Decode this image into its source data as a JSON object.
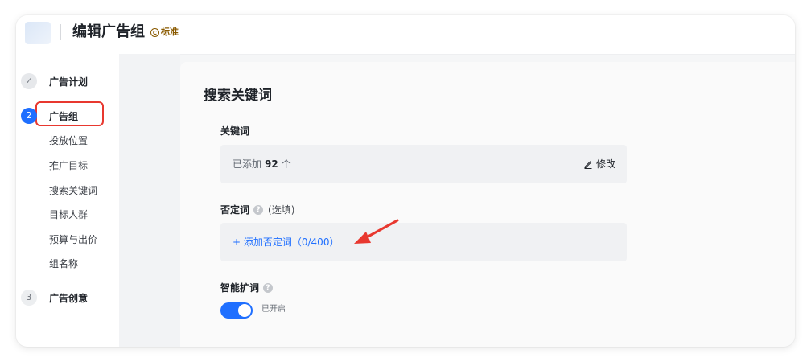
{
  "header": {
    "title": "编辑广告组",
    "badge_icon": "C",
    "badge": "标准"
  },
  "sidebar": {
    "steps": [
      {
        "number": "✓",
        "label": "广告计划",
        "state": "done"
      },
      {
        "number": "2",
        "label": "广告组",
        "state": "active"
      },
      {
        "number": "3",
        "label": "广告创意",
        "state": "todo"
      }
    ],
    "sub_items": [
      "投放位置",
      "推广目标",
      "搜索关键词",
      "目标人群",
      "预算与出价",
      "组名称"
    ]
  },
  "main": {
    "section_title": "搜索关键词",
    "keywords": {
      "label": "关键词",
      "added_prefix": "已添加",
      "count": "92",
      "added_suffix": "个",
      "edit_label": "修改"
    },
    "negative": {
      "label": "否定词",
      "optional": "(选填)",
      "add_label": "+ 添加否定词（0/400）"
    },
    "smart": {
      "label": "智能扩词",
      "toggle_on": true,
      "toggle_status": "已开启"
    }
  },
  "colors": {
    "accent": "#1f6fff",
    "highlight_red": "#e8382f",
    "badge_gold": "#8a5a00"
  }
}
